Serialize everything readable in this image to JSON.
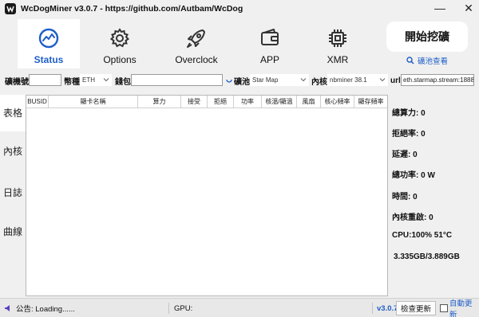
{
  "window": {
    "title": "WcDogMiner  v3.0.7 -  https://github.com/Autbam/WcDog",
    "minimize_glyph": "—",
    "close_glyph": "✕"
  },
  "nav": {
    "tabs": [
      {
        "label": "Status",
        "icon": "gauge-icon",
        "active": true
      },
      {
        "label": "Options",
        "icon": "gear-icon",
        "active": false
      },
      {
        "label": "Overclock",
        "icon": "rocket-icon",
        "active": false
      },
      {
        "label": "APP",
        "icon": "wallet-icon",
        "active": false
      },
      {
        "label": "XMR",
        "icon": "cpu-chip-icon",
        "active": false
      }
    ],
    "start_button": "開始挖礦",
    "pool_link": "礦池查看"
  },
  "config": {
    "miner_no_label": "礦機號",
    "miner_no_value": "",
    "coin_label": "幣種",
    "coin_value": "ETH",
    "wallet_label": "錢包",
    "wallet_value": "",
    "pool_label": "礦池",
    "pool_value": "Star Map",
    "kernel_label": "內核",
    "kernel_value": "nbminer 38.1",
    "url_label": "url",
    "url_value": "eth.starmap.stream:18888"
  },
  "side_tabs": [
    "表格",
    "內核",
    "日誌",
    "曲線"
  ],
  "table": {
    "columns": [
      "BUSID",
      "顯卡名稱",
      "算力",
      "接受",
      "拒絕",
      "功率",
      "核溫/顯溫",
      "風扇",
      "核心頻率",
      "顯存頻率"
    ],
    "rows": []
  },
  "stats": [
    "總算力: 0",
    "拒絕率: 0",
    "延遲: 0",
    "總功率: 0 W",
    "時間: 0",
    "內核重啟: 0",
    "CPU:100% 51°C",
    "3.335GB/3.889GB"
  ],
  "statusbar": {
    "notice": "公告: Loading......",
    "gpu": "GPU:",
    "version": "v3.0.7",
    "check_update": "檢查更新",
    "auto_update": "自動更新",
    "auto_update_checked": false
  },
  "colors": {
    "accent": "#1e5ec8",
    "background": "#f0f0f0",
    "panel": "#ffffff"
  }
}
